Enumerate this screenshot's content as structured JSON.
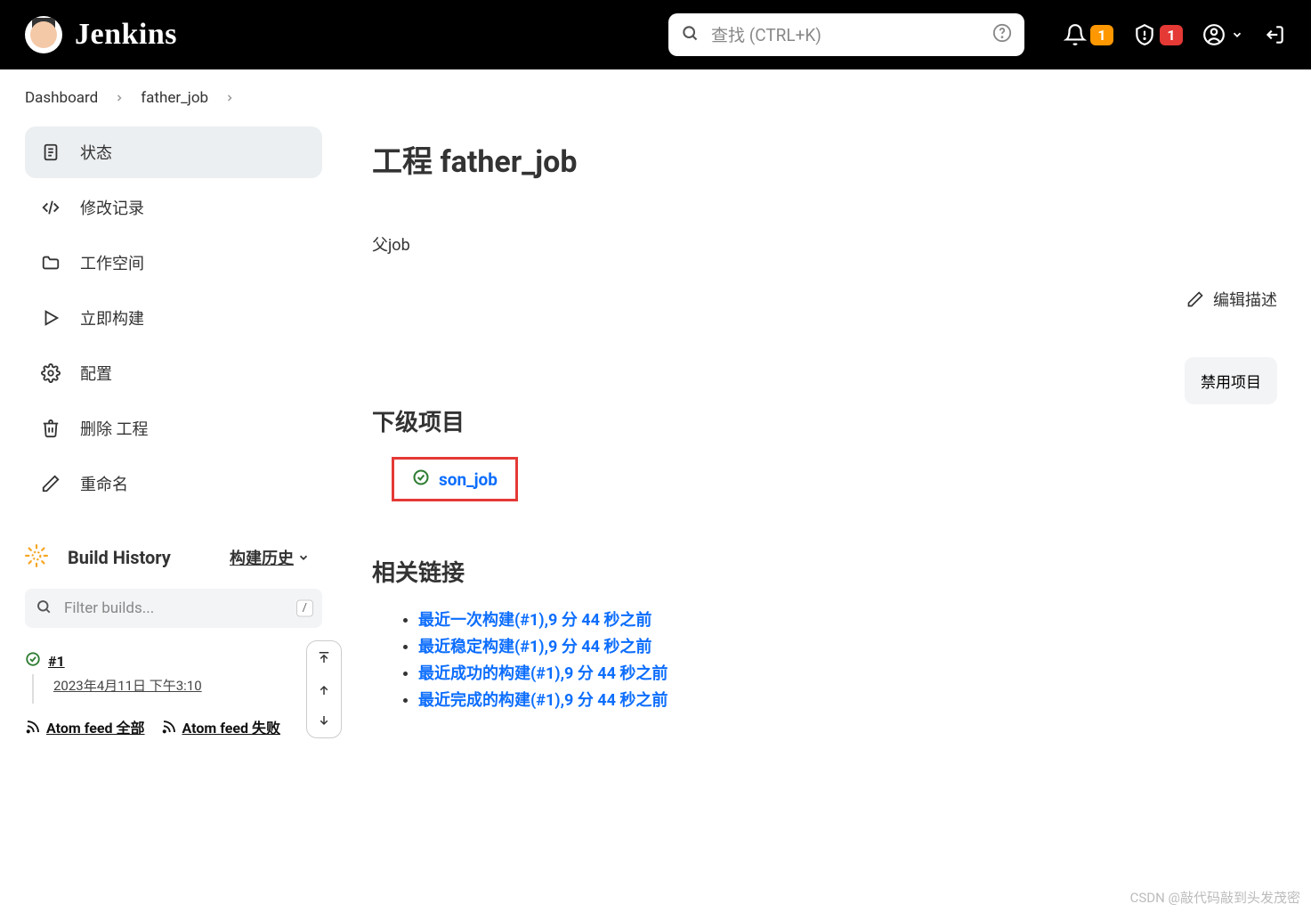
{
  "header": {
    "brand": "Jenkins",
    "search_placeholder": "查找 (CTRL+K)",
    "notif_badge": "1",
    "security_badge": "1"
  },
  "breadcrumbs": {
    "items": [
      "Dashboard",
      "father_job"
    ]
  },
  "sidebar": {
    "items": [
      {
        "label": "状态"
      },
      {
        "label": "修改记录"
      },
      {
        "label": "工作空间"
      },
      {
        "label": "立即构建"
      },
      {
        "label": "配置"
      },
      {
        "label": "删除 工程"
      },
      {
        "label": "重命名"
      }
    ],
    "build_history_title": "Build History",
    "build_history_sub": "构建历史",
    "filter_placeholder": "Filter builds...",
    "filter_kbd": "/",
    "builds": [
      {
        "id": "#1",
        "date": "2023年4月11日 下午3:10"
      }
    ],
    "feed_all": "Atom feed 全部",
    "feed_fail": "Atom feed 失败"
  },
  "main": {
    "title": "工程 father_job",
    "description": "父job",
    "edit_desc": "编辑描述",
    "disable_btn": "禁用项目",
    "downstream_heading": "下级项目",
    "downstream_link": "son_job",
    "related_heading": "相关链接",
    "links": [
      "最近一次构建(#1),9 分 44 秒之前",
      "最近稳定构建(#1),9 分 44 秒之前",
      "最近成功的构建(#1),9 分 44 秒之前",
      "最近完成的构建(#1),9 分 44 秒之前"
    ]
  },
  "watermark": "CSDN @敲代码敲到头发茂密"
}
